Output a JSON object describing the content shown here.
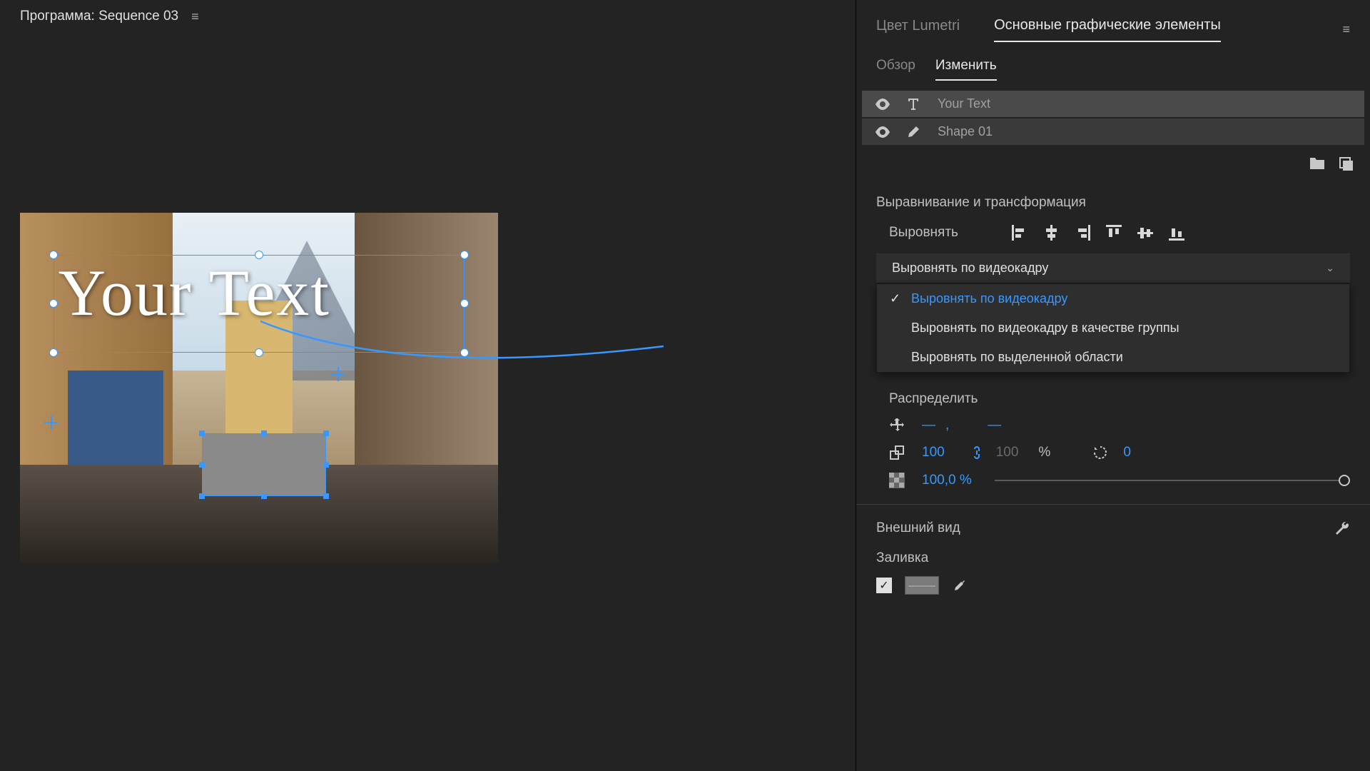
{
  "program": {
    "label": "Программа: Sequence 03"
  },
  "overlay_text": "Your Text",
  "panel_tabs": {
    "lumetri": "Цвет Lumetri",
    "graphics": "Основные графические элементы"
  },
  "sub_tabs": {
    "overview": "Обзор",
    "edit": "Изменить"
  },
  "layers": [
    {
      "name": "Your Text",
      "type": "text"
    },
    {
      "name": "Shape 01",
      "type": "shape"
    }
  ],
  "align_section": {
    "title": "Выравнивание и трансформация",
    "align_label": "Выровнять",
    "distribute_label": "Распределить",
    "dropdown_label": "Выровнять по видеокадру",
    "options": [
      "Выровнять по видеокадру",
      "Выровнять по видеокадру в качестве группы",
      "Выровнять по выделенной области"
    ]
  },
  "transform": {
    "pos_sep": ",",
    "scale": "100",
    "scale_y": "100",
    "percent": "%",
    "rotation": "0",
    "opacity": "100,0 %"
  },
  "appearance": {
    "title": "Внешний вид",
    "fill_label": "Заливка"
  }
}
